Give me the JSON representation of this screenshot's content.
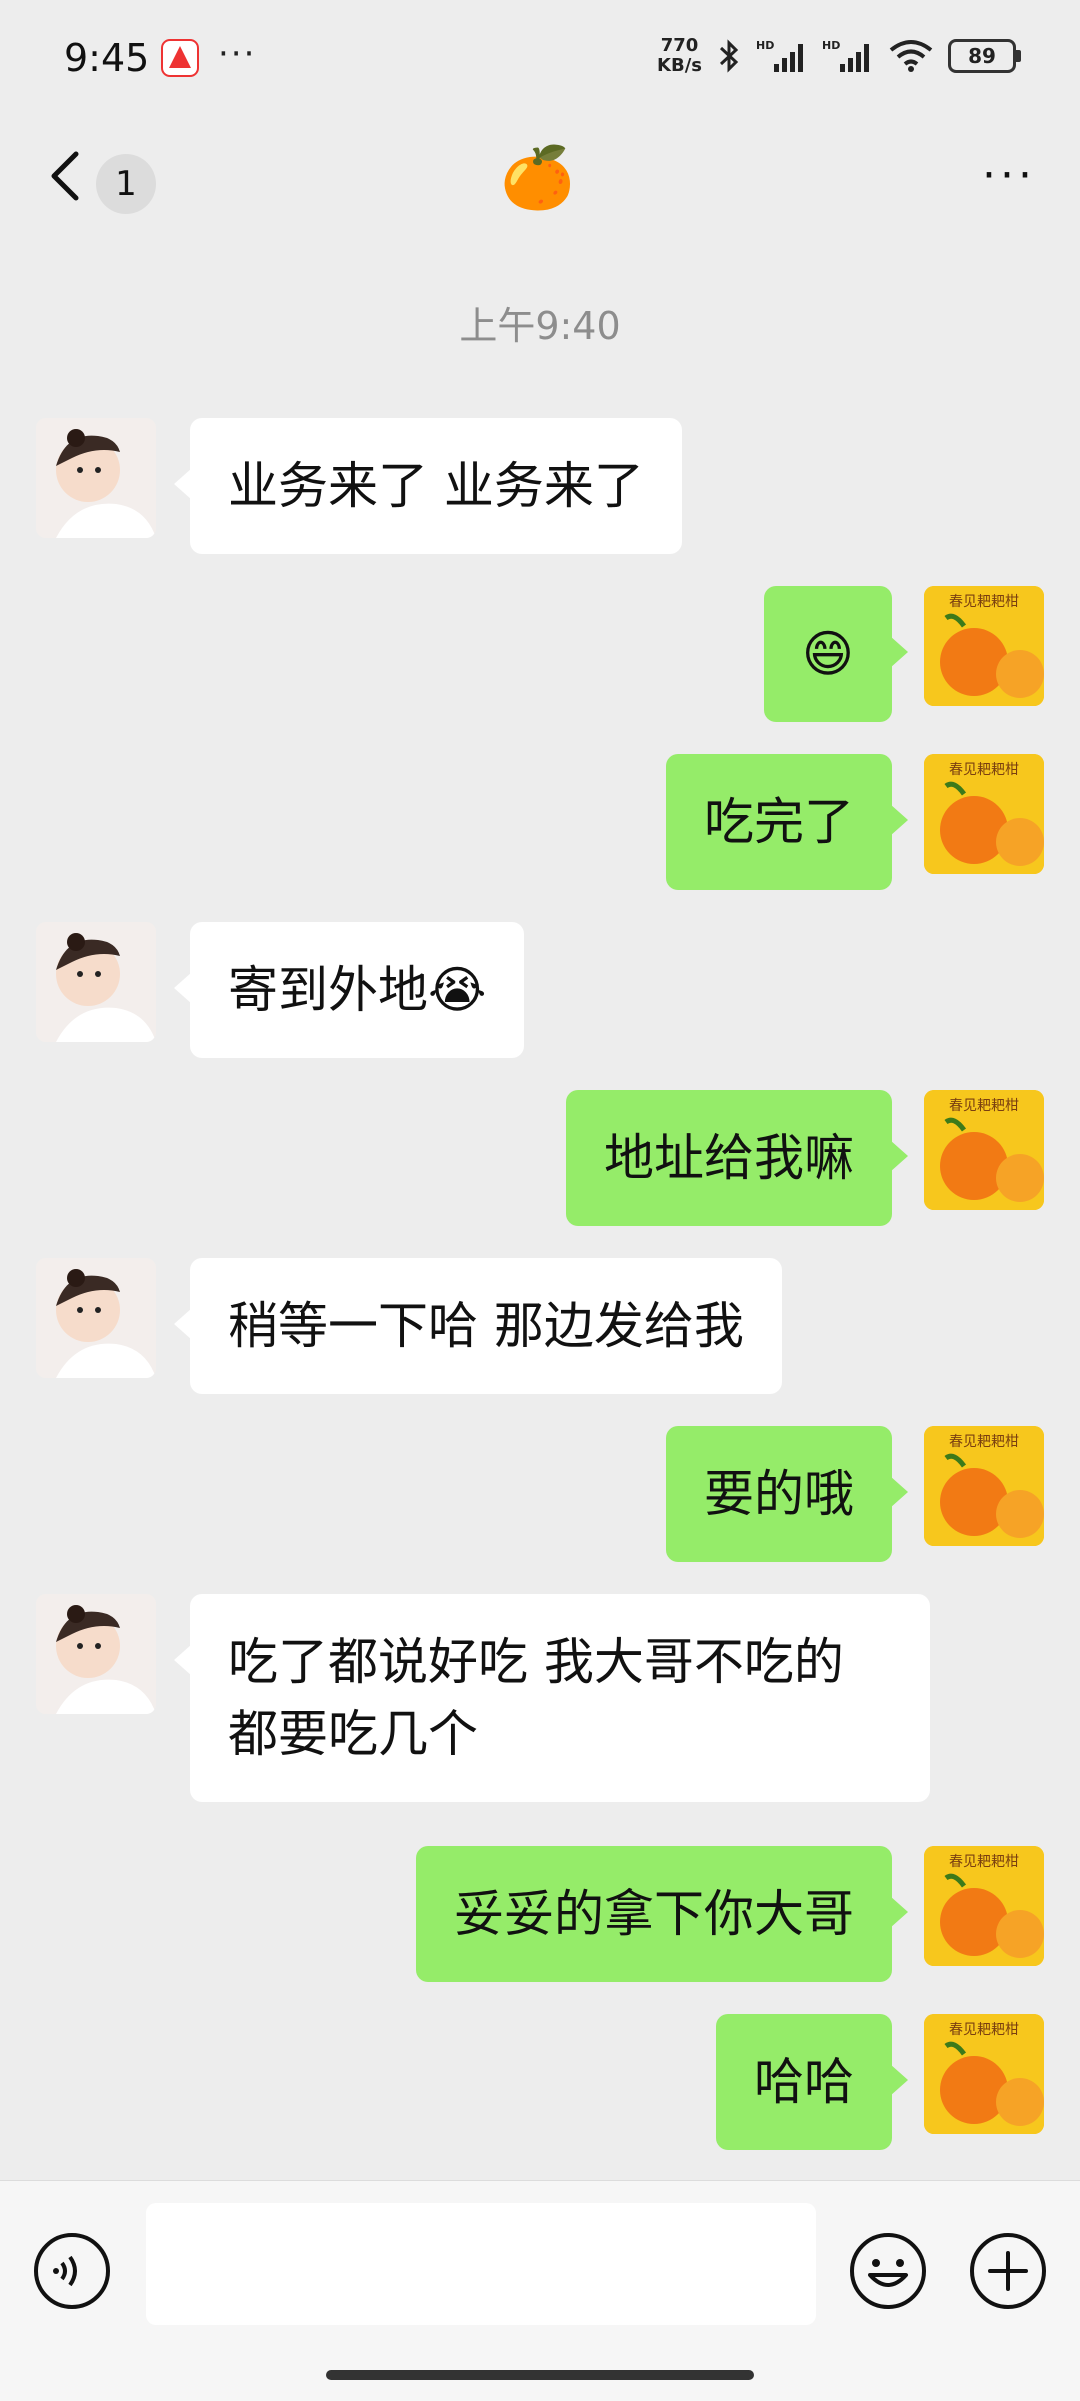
{
  "status_bar": {
    "time": "9:45",
    "more": "···",
    "net_speed_value": "770",
    "net_speed_unit": "KB/s",
    "battery": "89"
  },
  "header": {
    "back_label": "<",
    "unread_count": "1",
    "title": "🍊",
    "menu": "···"
  },
  "timestamp": "上午9:40",
  "messages": [
    {
      "side": "left",
      "text": "业务来了 业务来了"
    },
    {
      "side": "right",
      "text": "😄"
    },
    {
      "side": "right",
      "text": "吃完了"
    },
    {
      "side": "left",
      "text": "寄到外地😭"
    },
    {
      "side": "right",
      "text": "地址给我嘛"
    },
    {
      "side": "left",
      "text": "稍等一下哈 那边发给我"
    },
    {
      "side": "right",
      "text": "要的哦"
    },
    {
      "side": "left",
      "text": "吃了都说好吃  我大哥不吃的都要吃几个"
    },
    {
      "side": "right",
      "text": "妥妥的拿下你大哥"
    },
    {
      "side": "right",
      "text": "哈哈"
    }
  ],
  "contact_avatar_text": "春见耙耙柑",
  "input": {
    "placeholder": ""
  },
  "colors": {
    "self_bubble": "#95ec69",
    "other_bubble": "#ffffff",
    "background": "#ededed"
  }
}
